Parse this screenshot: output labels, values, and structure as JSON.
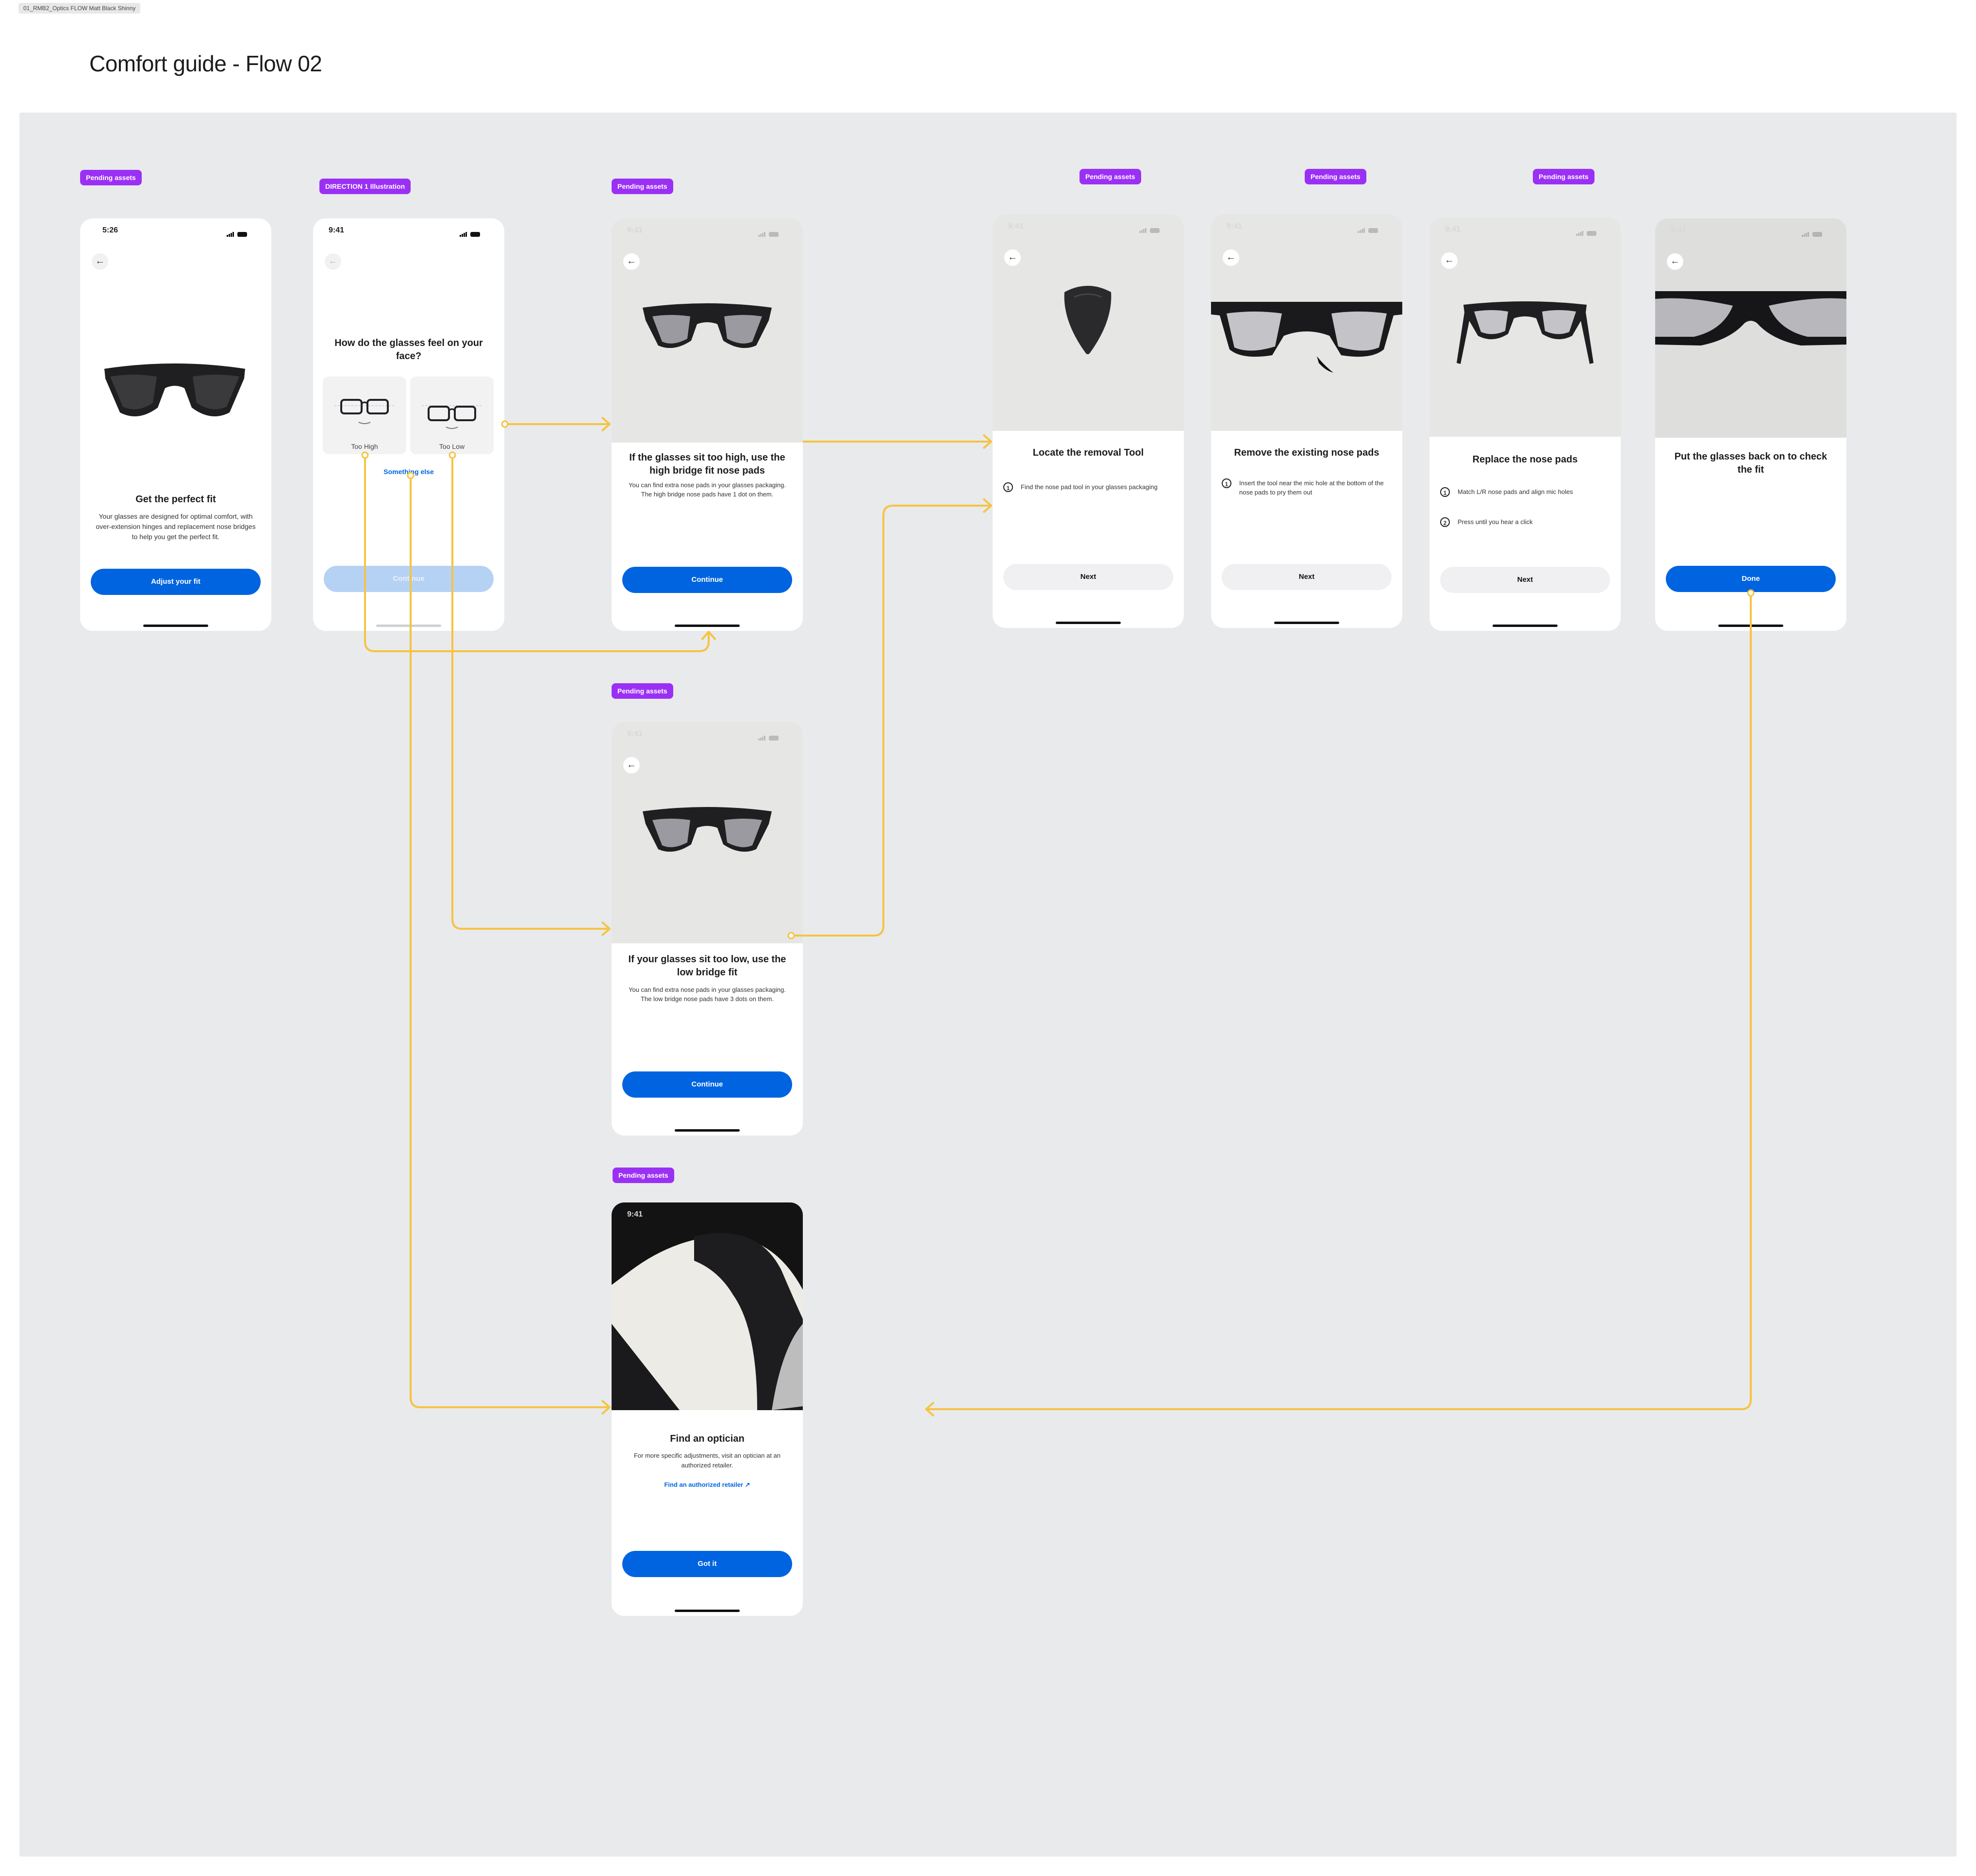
{
  "file_tag": "01_RMB2_Optics FLOW Matt Black Shinny",
  "page_title": "Comfort guide - Flow 02",
  "tags": {
    "pending": "Pending assets",
    "direction": "DIRECTION 1 Illustration"
  },
  "screens": {
    "s1": {
      "time": "5:26",
      "title": "Get the perfect fit",
      "body": "Your glasses are designed for optimal comfort, with over-extension hinges and replacement nose bridges to help you get the perfect fit.",
      "button": "Adjust your fit"
    },
    "s2": {
      "time": "9:41",
      "title": "How do the glasses feel on your face?",
      "option_high": "Too High",
      "option_low": "Too Low",
      "link": "Something else",
      "button": "Continue"
    },
    "s3": {
      "time": "9:41",
      "title": "If the glasses sit too high, use the high bridge fit nose pads",
      "body": "You can find extra nose pads in your glasses packaging. The high bridge nose pads have 1 dot on them.",
      "button": "Continue"
    },
    "s4": {
      "time": "9:41",
      "title": "Locate the removal Tool",
      "steps": [
        "Find the nose pad tool in your glasses packaging"
      ],
      "button": "Next"
    },
    "s5": {
      "time": "9:41",
      "title": "Remove the existing nose pads",
      "steps": [
        "Insert the tool near the mic hole at the bottom of the nose pads to pry them out"
      ],
      "button": "Next"
    },
    "s6": {
      "time": "9:41",
      "title": "Replace the nose pads",
      "steps": [
        "Match L/R nose pads and align mic holes",
        "Press until you hear a click"
      ],
      "button": "Next"
    },
    "s7": {
      "time": "9:41",
      "title": "Put the glasses back on to check the fit",
      "button": "Done"
    },
    "s8": {
      "time": "9:41",
      "title": "If your glasses sit too low, use the low bridge fit",
      "body": "You can find extra nose pads in your glasses packaging. The low bridge nose pads have 3 dots on them.",
      "button": "Continue"
    },
    "s9": {
      "time": "9:41",
      "title": "Find an optician",
      "body": "For more specific adjustments, visit an optician at an authorized retailer.",
      "link": "Find an authorized retailer",
      "button": "Got it"
    }
  },
  "step_numbers": [
    "1",
    "2"
  ],
  "icons": [
    "back-arrow-icon",
    "signal-icon",
    "wifi-icon",
    "battery-icon",
    "external-link-icon",
    "sunglasses-illustration",
    "removal-tool-illustration",
    "glasses-face-illustration"
  ],
  "colors": {
    "canvas": "#e9eaec",
    "primary": "#0064e0",
    "tag": "#9b30f5",
    "connector": "#f6c342"
  }
}
